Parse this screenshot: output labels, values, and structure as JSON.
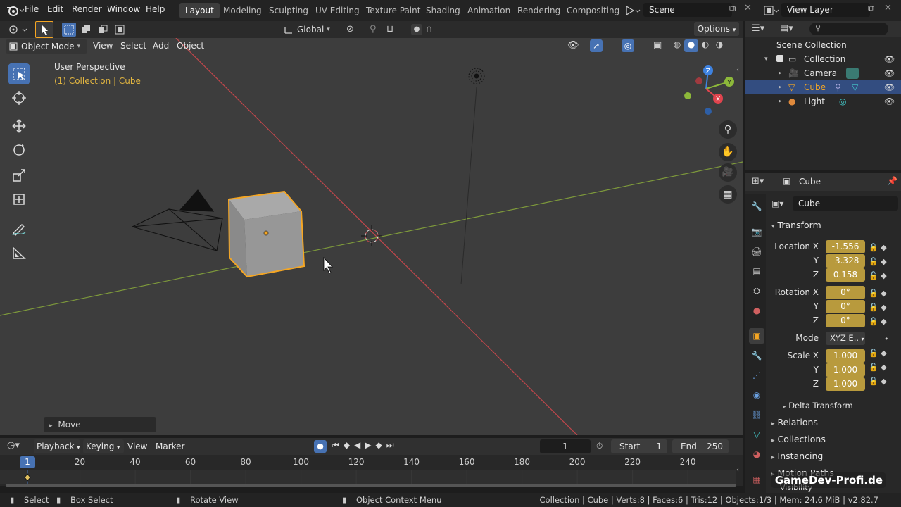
{
  "menus": [
    "File",
    "Edit",
    "Render",
    "Window",
    "Help"
  ],
  "workspaces": [
    "Layout",
    "Modeling",
    "Sculpting",
    "UV Editing",
    "Texture Paint",
    "Shading",
    "Animation",
    "Rendering",
    "Compositing"
  ],
  "scene": "Scene",
  "view_layer": "View Layer",
  "toolbar": {
    "orientation": "Global",
    "options": "Options"
  },
  "viewport_header": {
    "mode": "Object Mode",
    "items": [
      "View",
      "Select",
      "Add",
      "Object"
    ]
  },
  "viewport": {
    "perspective": "User Perspective",
    "collection_info": "(1) Collection | Cube",
    "gizmo_axes": {
      "x": "X",
      "y": "Y",
      "z": "Z"
    }
  },
  "last_op": "Move",
  "outliner": {
    "root": "Scene Collection",
    "collection": "Collection",
    "objects": [
      "Camera",
      "Cube",
      "Light"
    ]
  },
  "properties": {
    "header_object": "Cube",
    "object_name": "Cube",
    "transform_label": "Transform",
    "location": {
      "label_x": "Location X",
      "label_y": "Y",
      "label_z": "Z",
      "x": "-1.556",
      "y": "-3.328",
      "z": "0.158"
    },
    "rotation": {
      "label_x": "Rotation X",
      "label_y": "Y",
      "label_z": "Z",
      "x": "0°",
      "y": "0°",
      "z": "0°"
    },
    "mode": {
      "label": "Mode",
      "value": "XYZ E.."
    },
    "scale": {
      "label_x": "Scale X",
      "label_y": "Y",
      "label_z": "Z",
      "x": "1.000",
      "y": "1.000",
      "z": "1.000"
    },
    "sections": [
      "Delta Transform",
      "Relations",
      "Collections",
      "Instancing",
      "Motion Paths",
      "Visibility"
    ]
  },
  "timeline": {
    "menus": [
      "Playback",
      "Keying",
      "View",
      "Marker"
    ],
    "current_frame": "1",
    "start_label": "Start",
    "start": "1",
    "end_label": "End",
    "end": "250",
    "ticks": [
      "1",
      "20",
      "40",
      "60",
      "80",
      "100",
      "120",
      "140",
      "160",
      "180",
      "200",
      "220",
      "240"
    ]
  },
  "status": {
    "select": "Select",
    "box_select": "Box Select",
    "rotate_view": "Rotate View",
    "context_menu": "Object Context Menu",
    "stats": "Collection | Cube | Verts:8 | Faces:6 | Tris:12 | Objects:1/3 | Mem: 24.6 MiB | v2.82.7"
  },
  "watermark": "GameDev-Profi.de",
  "colors": {
    "accent": "#4772b3",
    "selection": "#f5a623",
    "field_anim": "#b89a3d",
    "x_axis": "#e0444e",
    "y_axis": "#8db83a",
    "z_axis": "#3e82e0"
  }
}
